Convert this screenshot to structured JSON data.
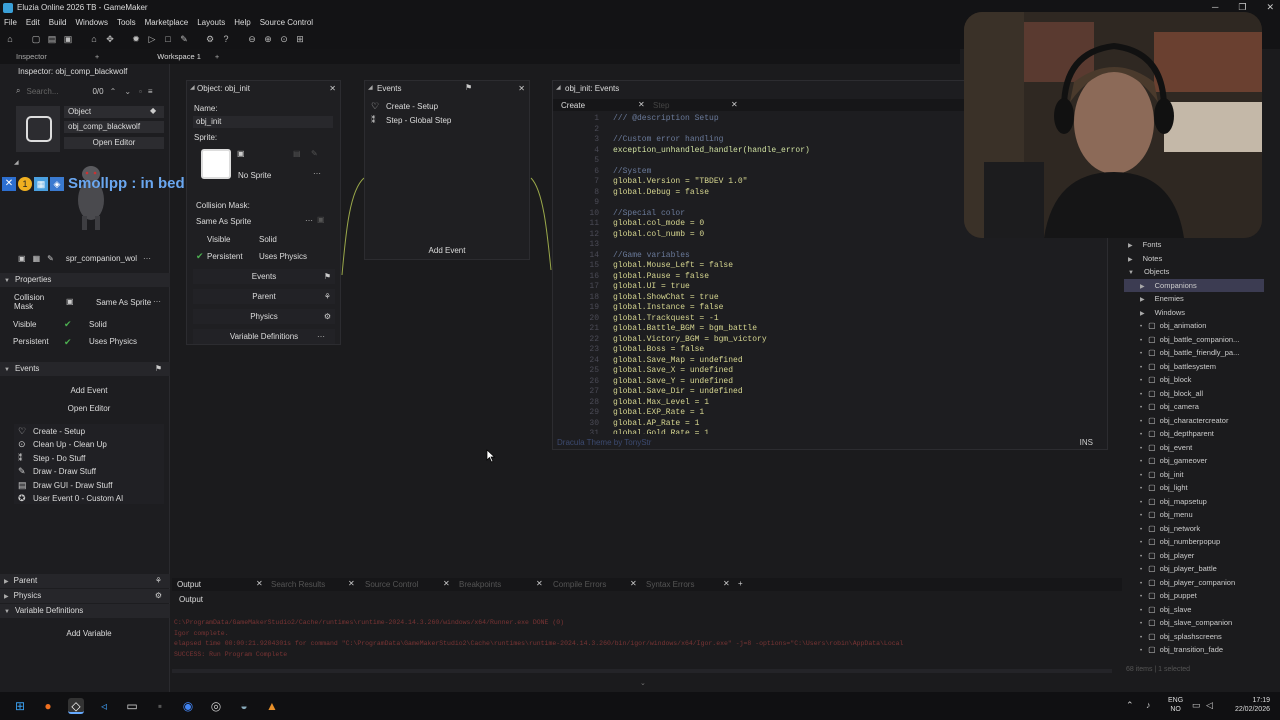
{
  "window": {
    "title": "Eluzia Online 2026 TB - GameMaker"
  },
  "menu": [
    "File",
    "Edit",
    "Build",
    "Windows",
    "Tools",
    "Marketplace",
    "Layouts",
    "Help",
    "Source Control"
  ],
  "tabs": {
    "inspector": "Inspector",
    "workspace": "Workspace 1"
  },
  "inspector": {
    "title": "Inspector: obj_comp_blackwolf",
    "search_placeholder": "Search...",
    "count": "0/0",
    "type_label": "Object",
    "object_name": "obj_comp_blackwolf",
    "open_editor": "Open Editor",
    "sprite_name": "spr_companion_wol",
    "properties_label": "Properties",
    "collision_mask_label": "Collision Mask",
    "collision_mask_value": "Same As Sprite",
    "visible_label": "Visible",
    "solid_label": "Solid",
    "persistent_label": "Persistent",
    "uses_physics_label": "Uses Physics",
    "events_label": "Events",
    "add_event": "Add Event",
    "open_editor2": "Open Editor",
    "events": [
      {
        "icon": "lightbulb-icon",
        "label": "Create - Setup"
      },
      {
        "icon": "cleanup-icon",
        "label": "Clean Up - Clean Up"
      },
      {
        "icon": "step-icon",
        "label": "Step - Do Stuff"
      },
      {
        "icon": "draw-icon",
        "label": "Draw - Draw Stuff"
      },
      {
        "icon": "drawgui-icon",
        "label": "Draw GUI - Draw Stuff"
      },
      {
        "icon": "user-event-icon",
        "label": "User Event 0 - Custom AI"
      }
    ],
    "parent_label": "Parent",
    "physics_label": "Physics",
    "variable_defs_label": "Variable Definitions",
    "add_variable": "Add Variable"
  },
  "overlay": {
    "text": "Smollpp : in bed"
  },
  "object_panel": {
    "title": "Object: obj_init",
    "name_label": "Name:",
    "name_value": "obj_init",
    "sprite_label": "Sprite:",
    "no_sprite": "No Sprite",
    "collision_mask_label": "Collision Mask:",
    "collision_mask_value": "Same As Sprite",
    "visible": "Visible",
    "solid": "Solid",
    "persistent": "Persistent",
    "uses_physics": "Uses Physics",
    "events_btn": "Events",
    "parent_btn": "Parent",
    "physics_btn": "Physics",
    "vardefs_btn": "Variable Definitions"
  },
  "events_panel": {
    "title": "Events",
    "items": [
      {
        "label": "Create - Setup"
      },
      {
        "label": "Step - Global Step"
      }
    ],
    "add_event": "Add Event"
  },
  "code_panel": {
    "title": "obj_init: Events",
    "tab_create": "Create",
    "tab_step": "Step",
    "footer_theme": "Dracula Theme by TonyStr",
    "footer_mode": "INS",
    "lines": [
      {
        "n": "1",
        "t": "/// @description Setup",
        "k": "com"
      },
      {
        "n": "2",
        "t": "",
        "k": ""
      },
      {
        "n": "3",
        "t": "//Custom error handling",
        "k": "com"
      },
      {
        "n": "4",
        "t": "exception_unhandled_handler(handle_error)",
        "k": "fn"
      },
      {
        "n": "5",
        "t": "",
        "k": ""
      },
      {
        "n": "6",
        "t": "//System",
        "k": "com"
      },
      {
        "n": "7",
        "t": "global.Version = \"TBDEV 1.0\"",
        "k": "glob"
      },
      {
        "n": "8",
        "t": "global.Debug = false",
        "k": "glob"
      },
      {
        "n": "9",
        "t": "",
        "k": ""
      },
      {
        "n": "10",
        "t": "//Special color",
        "k": "com"
      },
      {
        "n": "11",
        "t": "global.col_mode = 0",
        "k": "glob"
      },
      {
        "n": "12",
        "t": "global.col_numb = 0",
        "k": "glob"
      },
      {
        "n": "13",
        "t": "",
        "k": ""
      },
      {
        "n": "14",
        "t": "//Game variables",
        "k": "com"
      },
      {
        "n": "15",
        "t": "global.Mouse_Left = false",
        "k": "glob"
      },
      {
        "n": "16",
        "t": "global.Pause = false",
        "k": "glob"
      },
      {
        "n": "17",
        "t": "global.UI = true",
        "k": "glob"
      },
      {
        "n": "18",
        "t": "global.ShowChat = true",
        "k": "glob"
      },
      {
        "n": "19",
        "t": "global.Instance = false",
        "k": "glob"
      },
      {
        "n": "20",
        "t": "global.Trackquest = -1",
        "k": "glob"
      },
      {
        "n": "21",
        "t": "global.Battle_BGM = bgm_battle",
        "k": "glob"
      },
      {
        "n": "22",
        "t": "global.Victory_BGM = bgm_victory",
        "k": "glob"
      },
      {
        "n": "23",
        "t": "global.Boss = false",
        "k": "glob"
      },
      {
        "n": "24",
        "t": "global.Save_Map = undefined",
        "k": "glob"
      },
      {
        "n": "25",
        "t": "global.Save_X = undefined",
        "k": "glob"
      },
      {
        "n": "26",
        "t": "global.Save_Y = undefined",
        "k": "glob"
      },
      {
        "n": "27",
        "t": "global.Save_Dir = undefined",
        "k": "glob"
      },
      {
        "n": "28",
        "t": "global.Max_Level = 1",
        "k": "glob"
      },
      {
        "n": "29",
        "t": "global.EXP_Rate = 1",
        "k": "glob"
      },
      {
        "n": "30",
        "t": "global.AP_Rate = 1",
        "k": "glob"
      },
      {
        "n": "31",
        "t": "global.Gold_Rate = 1",
        "k": "glob"
      }
    ]
  },
  "asset_tree": {
    "items": [
      {
        "label": "Fonts",
        "icon": "folder-icon",
        "sel": false
      },
      {
        "label": "Notes",
        "icon": "folder-icon",
        "sel": false
      },
      {
        "label": "Objects",
        "icon": "folder-icon",
        "sel": false
      },
      {
        "label": "Companions",
        "icon": "folder-icon",
        "sel": true
      },
      {
        "label": "Enemies",
        "icon": "folder-icon",
        "sel": false
      },
      {
        "label": "Windows",
        "icon": "folder-icon",
        "sel": false
      },
      {
        "label": "obj_animation",
        "icon": "object-icon",
        "sel": false
      },
      {
        "label": "obj_battle_companion...",
        "icon": "object-icon",
        "sel": false
      },
      {
        "label": "obj_battle_friendly_pa...",
        "icon": "object-icon",
        "sel": false
      },
      {
        "label": "obj_battlesystem",
        "icon": "object-icon",
        "sel": false
      },
      {
        "label": "obj_block",
        "icon": "object-icon",
        "sel": false
      },
      {
        "label": "obj_block_all",
        "icon": "object-icon",
        "sel": false
      },
      {
        "label": "obj_camera",
        "icon": "object-icon",
        "sel": false
      },
      {
        "label": "obj_charactercreator",
        "icon": "object-icon",
        "sel": false
      },
      {
        "label": "obj_depthparent",
        "icon": "object-icon",
        "sel": false
      },
      {
        "label": "obj_event",
        "icon": "object-icon",
        "sel": false
      },
      {
        "label": "obj_gameover",
        "icon": "object-icon",
        "sel": false
      },
      {
        "label": "obj_init",
        "icon": "object-icon",
        "sel": false
      },
      {
        "label": "obj_light",
        "icon": "object-icon",
        "sel": false
      },
      {
        "label": "obj_mapsetup",
        "icon": "object-icon",
        "sel": false
      },
      {
        "label": "obj_menu",
        "icon": "object-icon",
        "sel": false
      },
      {
        "label": "obj_network",
        "icon": "object-icon",
        "sel": false
      },
      {
        "label": "obj_numberpopup",
        "icon": "object-icon",
        "sel": false
      },
      {
        "label": "obj_player",
        "icon": "object-icon",
        "sel": false
      },
      {
        "label": "obj_player_battle",
        "icon": "object-icon",
        "sel": false
      },
      {
        "label": "obj_player_companion",
        "icon": "object-icon",
        "sel": false
      },
      {
        "label": "obj_puppet",
        "icon": "object-icon",
        "sel": false
      },
      {
        "label": "obj_slave",
        "icon": "object-icon",
        "sel": false
      },
      {
        "label": "obj_slave_companion",
        "icon": "object-icon",
        "sel": false
      },
      {
        "label": "obj_splashscreens",
        "icon": "object-icon",
        "sel": false
      },
      {
        "label": "obj_transition_fade",
        "icon": "object-icon",
        "sel": false
      }
    ],
    "footer": "68 items | 1 selected"
  },
  "output": {
    "tabs": [
      "Output",
      "Search Results",
      "Source Control",
      "Breakpoints",
      "Compile Errors",
      "Syntax Errors"
    ],
    "label": "Output",
    "lines": [
      "C:\\ProgramData/GameMakerStudio2/Cache/runtimes\\runtime-2024.14.3.260/windows/x64/Runner.exe DONE (0)",
      "Igor complete.",
      "elapsed time 00:00:21.9204301s for command \"C:\\ProgramData\\GameMakerStudio2\\Cache\\runtimes\\runtime-2024.14.3.260/bin/igor/windows/x64/Igor.exe\" -j=8  -options=\"C:\\Users\\robin\\AppData\\Local",
      "SUCCESS: Run Program Complete"
    ]
  },
  "taskbar": {
    "lang": "ENG",
    "kbd": "NO",
    "time": "17:19",
    "date": "22/02/2026"
  }
}
